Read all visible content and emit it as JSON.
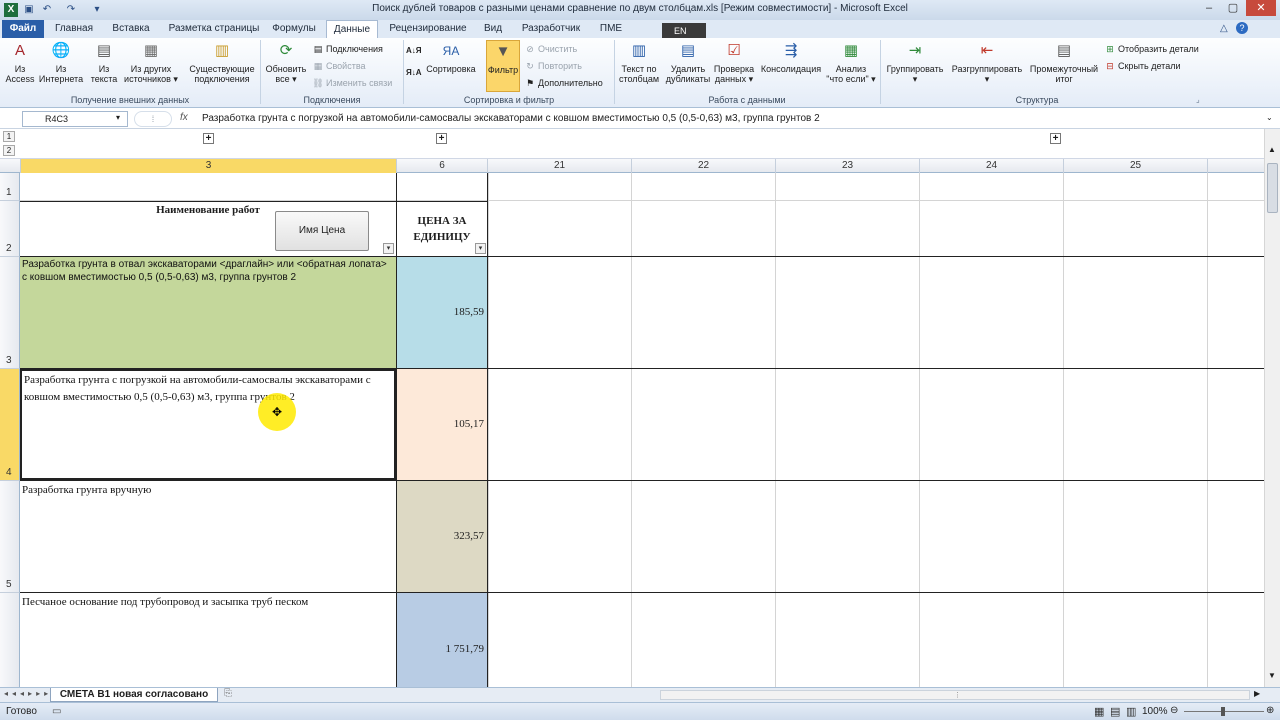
{
  "window": {
    "title": "Поиск дублей товаров с разными ценами сравнение по двум столбцам.xls  [Режим совместимости]  -  Microsoft Excel"
  },
  "tabs": [
    "Файл",
    "Главная",
    "Вставка",
    "Разметка страницы",
    "Формулы",
    "Данные",
    "Рецензирование",
    "Вид",
    "Разработчик",
    "ПМЕ"
  ],
  "lang": "EN",
  "ribbon": {
    "ext": {
      "access": "Из\nAccess",
      "web": "Из\nИнтернета",
      "text": "Из\nтекста",
      "other": "Из других\nисточников ▾",
      "existing": "Существующие\nподключения",
      "label": "Получение внешних данных"
    },
    "conn": {
      "refresh": "Обновить\nвсе ▾",
      "connections": "Подключения",
      "props": "Свойства",
      "edit_links": "Изменить связи",
      "label": "Подключения"
    },
    "sort": {
      "az": "А↓Я",
      "za": "Я↓А",
      "sort": "Сортировка",
      "filter": "Фильтр",
      "clear": "Очистить",
      "reapply": "Повторить",
      "advanced": "Дополнительно",
      "label": "Сортировка и фильтр"
    },
    "tools": {
      "text_cols": "Текст по\nстолбцам",
      "remove_dup": "Удалить\nдубликаты",
      "validation": "Проверка\nданных ▾",
      "consolidate": "Консолидация",
      "whatif": "Анализ\n\"что если\" ▾",
      "label": "Работа с данными"
    },
    "outline": {
      "group": "Группировать\n▾",
      "ungroup": "Разгруппировать\n▾",
      "subtotal": "Промежуточный\nитог",
      "show": "Отобразить детали",
      "hide": "Скрыть детали",
      "label": "Структура"
    }
  },
  "formula_bar": {
    "name_box": "R4C3",
    "fx": "fx",
    "formula": "Разработка грунта с погрузкой на автомобили-самосвалы экскаваторами с ковшом вместимостью 0,5 (0,5-0,63) м3, группа грунтов 2"
  },
  "outline_levels": [
    "1",
    "2"
  ],
  "columns": [
    "3",
    "6",
    "21",
    "22",
    "23",
    "24",
    "25"
  ],
  "grid": {
    "header_name": "Наименование работ",
    "button_label": "Имя Цена",
    "header_price": "ЦЕНА ЗА ЕДИНИЦУ",
    "rows": [
      {
        "num": "1",
        "name": "",
        "price": ""
      },
      {
        "num": "2",
        "name": "",
        "price": ""
      },
      {
        "num": "3",
        "name": "Разработка грунта в отвал экскаваторами <драглайн> или <обратная лопата> с ковшом вместимостью 0,5 (0,5-0,63) м3, группа грунтов 2",
        "price": "185,59"
      },
      {
        "num": "4",
        "name": "Разработка грунта с погрузкой на автомобили-самосвалы экскаваторами с ковшом вместимостью 0,5 (0,5-0,63) м3, группа грунтов 2",
        "price": "105,17"
      },
      {
        "num": "5",
        "name": "Разработка грунта вручную",
        "price": "323,57"
      },
      {
        "num": "",
        "name": "Песчаное основание под трубопровод и засыпка труб песком",
        "price": "1 751,79"
      }
    ]
  },
  "sheet": {
    "tab": "СМЕТА  В1 новая  согласовано"
  },
  "status": {
    "ready": "Готово",
    "zoom": "100%"
  },
  "colors": {
    "row3_name": "#c4d79b",
    "row3_price": "#b7dde8",
    "row4_price": "#fde9d9",
    "row5_price": "#ddd9c4",
    "row6_price": "#b8cce4",
    "selection": "#f9d966"
  }
}
